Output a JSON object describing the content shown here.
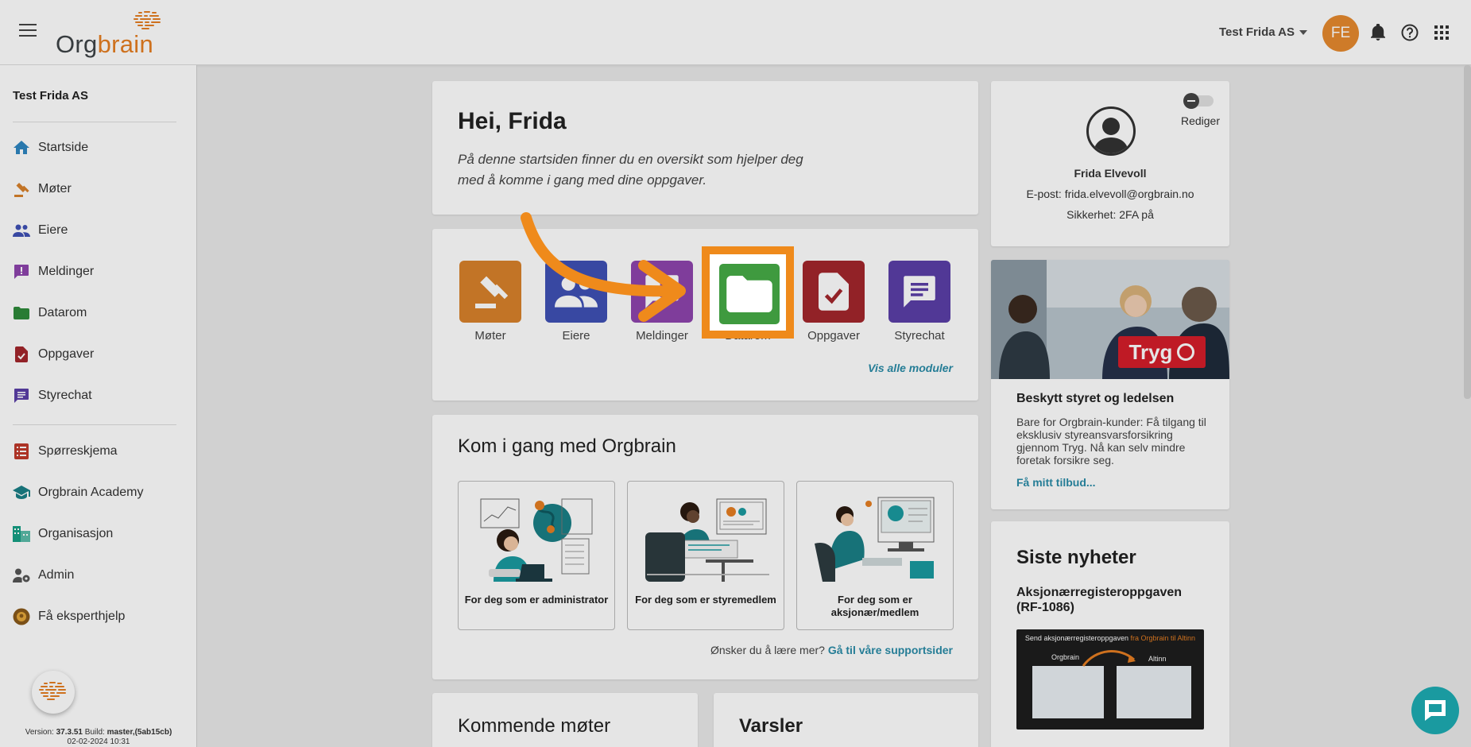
{
  "header": {
    "logo_text_a": "Org",
    "logo_text_b": "brain",
    "company": "Test Frida AS",
    "avatar_initials": "FE"
  },
  "sidebar": {
    "org_name": "Test Frida AS",
    "items": [
      {
        "label": "Startside",
        "icon": "home-icon"
      },
      {
        "label": "Møter",
        "icon": "gavel-icon"
      },
      {
        "label": "Eiere",
        "icon": "people-icon"
      },
      {
        "label": "Meldinger",
        "icon": "message-alert-icon"
      },
      {
        "label": "Datarom",
        "icon": "folder-icon"
      },
      {
        "label": "Oppgaver",
        "icon": "task-icon"
      },
      {
        "label": "Styrechat",
        "icon": "chat-icon"
      }
    ],
    "items2": [
      {
        "label": "Spørreskjema",
        "icon": "survey-icon"
      },
      {
        "label": "Orgbrain Academy",
        "icon": "academy-icon"
      },
      {
        "label": "Organisasjon",
        "icon": "organization-icon"
      },
      {
        "label": "Admin",
        "icon": "admin-icon"
      },
      {
        "label": "Få eksperthjelp",
        "icon": "expert-help-icon"
      }
    ],
    "version_prefix": "Version:",
    "version": "37.3.51",
    "build_prefix": "Build:",
    "build": "master,(5ab15cb)",
    "build_date": "02-02-2024 10:31"
  },
  "greeting": {
    "title": "Hei, Frida",
    "text": "På denne startsiden finner du en oversikt som hjelper deg med å komme i gang med dine oppgaver."
  },
  "modules": {
    "items": [
      {
        "label": "Møter",
        "color": "#d9822b"
      },
      {
        "label": "Eiere",
        "color": "#3f51b5"
      },
      {
        "label": "Meldinger",
        "color": "#8e44ad"
      },
      {
        "label": "Datarom",
        "color": "#3f9a3f"
      },
      {
        "label": "Oppgaver",
        "color": "#a3262c"
      },
      {
        "label": "Styrechat",
        "color": "#5b3fa8"
      }
    ],
    "see_all": "Vis alle moduler"
  },
  "get_started": {
    "title": "Kom i gang med Orgbrain",
    "cards": [
      {
        "label": "For deg som er administrator"
      },
      {
        "label": "For deg som er styremedlem"
      },
      {
        "label": "For deg som er aksjonær/medlem"
      }
    ],
    "learn_text": "Ønsker du å lære mer?",
    "learn_link": "Gå til våre supportsider"
  },
  "upcoming": {
    "title": "Kommende møter"
  },
  "alerts": {
    "title": "Varsler"
  },
  "profile": {
    "edit": "Rediger",
    "name": "Frida Elvevoll",
    "email": "E-post: frida.elvevoll@orgbrain.no",
    "security": "Sikkerhet: 2FA på"
  },
  "ad": {
    "brand": "Tryg",
    "title": "Beskytt styret og ledelsen",
    "text": "Bare for Orgbrain-kunder: Få tilgang til eksklusiv styreansvarsforsikring gjennom Tryg. Nå kan selv mindre foretak forsikre seg.",
    "link": "Få mitt tilbud..."
  },
  "news": {
    "title": "Siste nyheter",
    "item_title": "Aksjonærregisteroppgaven (RF-1086)",
    "img_caption_a": "Send aksjonærregisteroppgaven ",
    "img_caption_b": "fra Orgbrain til Altinn",
    "img_left": "Orgbrain",
    "img_right": "Altinn"
  },
  "colors": {
    "accent": "#ef8a1b",
    "link": "#2a8ca8",
    "chat": "#1a9aa0"
  }
}
